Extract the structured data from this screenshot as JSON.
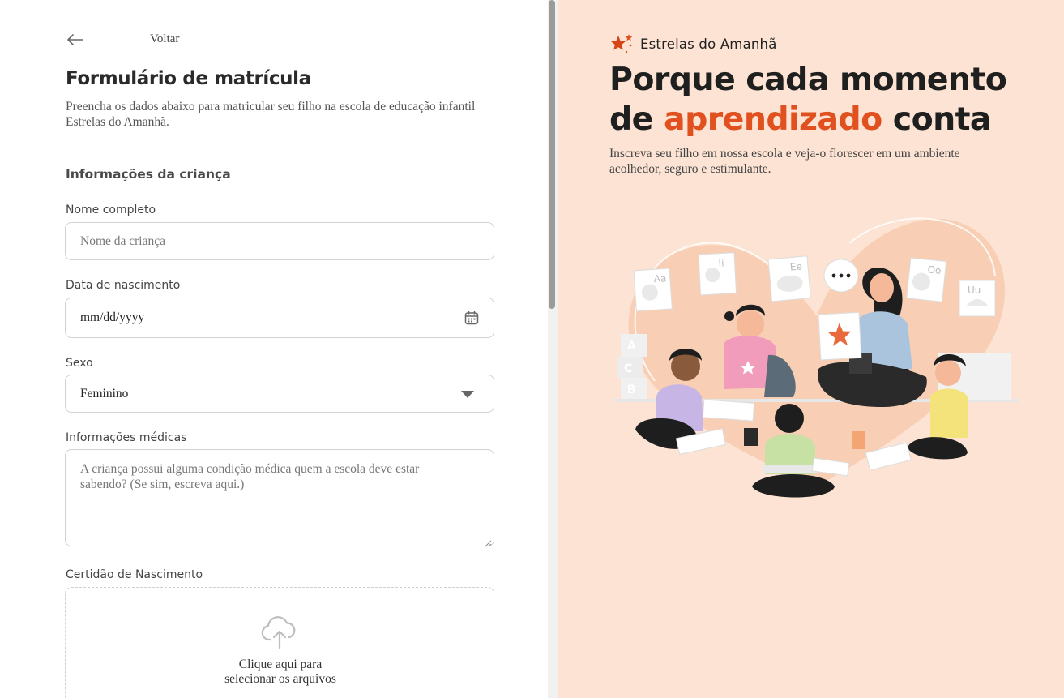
{
  "form": {
    "back_label": "Voltar",
    "title": "Formulário de matrícula",
    "subtitle": "Preencha os dados abaixo para matricular seu filho na escola de educação infantil Estrelas do Amanhã.",
    "section_child": "Informações da criança",
    "name_label": "Nome completo",
    "name_placeholder": "Nome da criança",
    "birth_label": "Data de nascimento",
    "birth_placeholder": "mm/dd/yyyy",
    "sex_label": "Sexo",
    "sex_value": "Feminino",
    "medical_label": "Informações médicas",
    "medical_placeholder": "A criança possui alguma condição médica quem a escola deve estar sabendo? (Se sim, escreva aqui.)",
    "cert_label": "Certidão de Nascimento",
    "upload_line1": "Clique aqui para",
    "upload_line2": "selecionar os arquivos"
  },
  "promo": {
    "brand": "Estrelas do Amanhã",
    "headline_part1": "Porque cada momento",
    "headline_part2": "de",
    "headline_accent": "aprendizado",
    "headline_part3": "conta",
    "lead": "Inscreva seu filho em nossa escola e veja-o florescer em um ambiente acolhedor, seguro e estimulante.",
    "card_labels": [
      "Aa",
      "Ii",
      "Ee",
      "Oo",
      "Uu"
    ],
    "block_letters": [
      "A",
      "C",
      "B"
    ]
  },
  "colors": {
    "accent": "#e1511f",
    "promo_bg": "#fce3d3",
    "heart": "#f8cfb4"
  },
  "icons": {
    "back": "arrow-left-icon",
    "calendar": "calendar-icon",
    "dropdown": "caret-down-icon",
    "upload": "cloud-upload-icon",
    "logo": "stars-logo-icon"
  }
}
